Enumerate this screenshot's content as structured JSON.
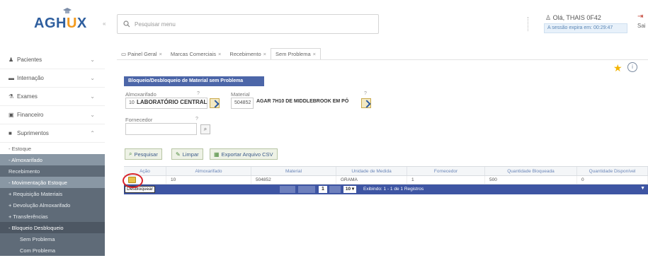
{
  "header": {
    "logo_main": "AGH",
    "logo_accent": "U",
    "logo_end": "X",
    "search_placeholder": "Pesquisar menu",
    "user_greeting": "Olá, THAIS 0F42",
    "session_text": "A sessão expira em: 00:29:47",
    "logout_label": "Sai"
  },
  "sidebar": {
    "items": [
      {
        "label": "Pacientes",
        "icon": "person-icon"
      },
      {
        "label": "Internação",
        "icon": "bed-icon"
      },
      {
        "label": "Exames",
        "icon": "flask-icon"
      },
      {
        "label": "Financeiro",
        "icon": "money-icon"
      },
      {
        "label": "Suprimentos",
        "icon": "box-icon"
      }
    ],
    "sub_items": [
      "- Estoque",
      "- Almoxarifado",
      "Recebimento",
      "- Movimentação Estoque",
      "+ Requisição Materiais",
      "+ Devolução Almoxarifado",
      "+ Transferências",
      "- Bloqueio Desbloqueio",
      "Sem Problema",
      "Com Problema"
    ]
  },
  "tabs": [
    {
      "label": "Painel Geral",
      "active": false
    },
    {
      "label": "Marcas Comerciais",
      "active": false
    },
    {
      "label": "Recebimento",
      "active": false
    },
    {
      "label": "Sem Problema",
      "active": true
    }
  ],
  "form": {
    "title": "Bloqueio/Desbloqueio de Material sem Problema",
    "almox_label": "Almoxarifado",
    "almox_code": "10",
    "almox_name": "LABORATÓRIO CENTRAL",
    "material_label": "Material",
    "material_code": "504852",
    "material_name": "AGAR 7H10 DE MIDDLEBROOK EM PÓ",
    "fornecedor_label": "Fornecedor",
    "fornecedor_value": "",
    "req_mark": "?"
  },
  "buttons": {
    "pesquisar": "Pesquisar",
    "limpar": "Limpar",
    "exportar": "Exportar Arquivo CSV"
  },
  "grid": {
    "columns": [
      "Ação",
      "Almoxarifado",
      "Material",
      "Unidade de Medida",
      "Fornecedor",
      "Quantidade Bloqueada",
      "Quantidade Disponível"
    ],
    "rows": [
      [
        "",
        "10",
        "504852",
        "GRAMA",
        "1",
        "500",
        "0"
      ]
    ],
    "tooltip": "Desbloquear",
    "page": "1",
    "page_size": "10 ▾",
    "summary": "Exibindo: 1 - 1 de 1 Registros"
  }
}
